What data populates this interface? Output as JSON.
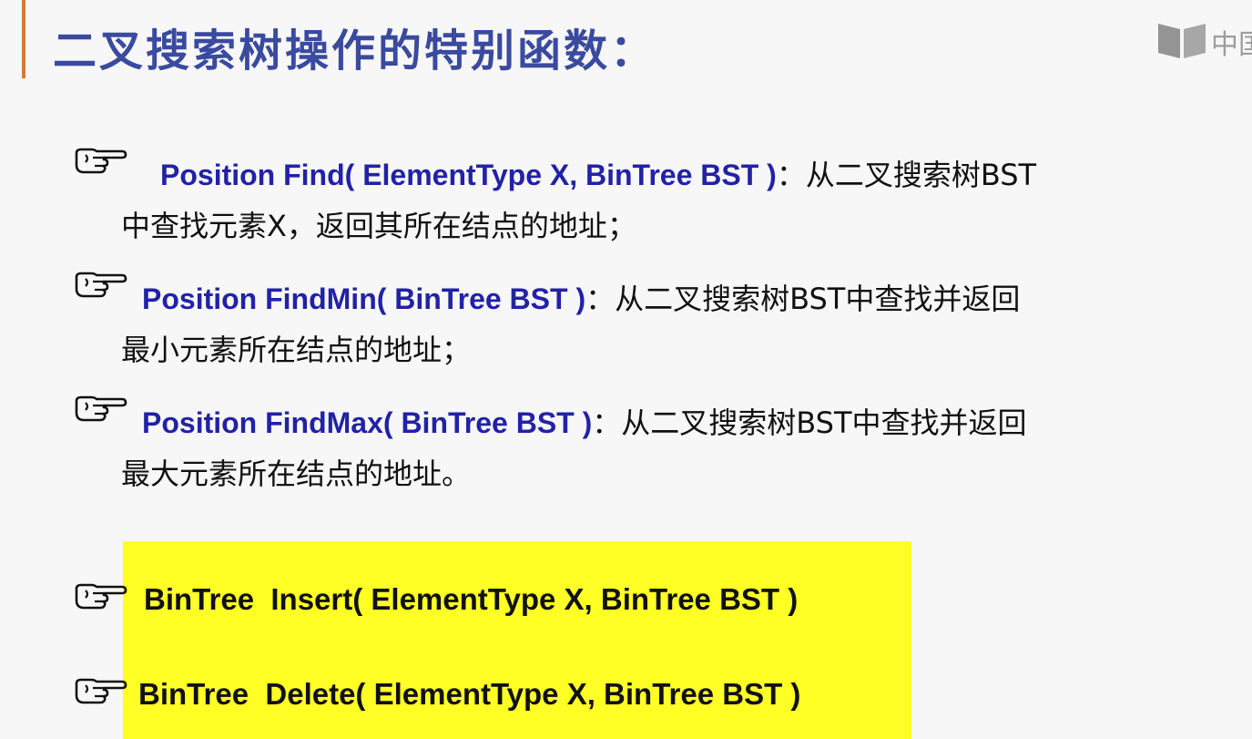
{
  "title": "二叉搜索树操作的特别函数：",
  "logo": {
    "text": "中国"
  },
  "items": [
    {
      "signature": "Position Find( ElementType X, BinTree BST )",
      "desc_line1": "：从二叉搜索树BST",
      "desc_line2": "中查找元素X，返回其所在结点的地址；"
    },
    {
      "signature": "Position FindMin( BinTree BST )",
      "desc_line1": "：从二叉搜索树BST中查找并返回",
      "desc_line2": "最小元素所在结点的地址；"
    },
    {
      "signature": "Position FindMax( BinTree BST )",
      "desc_line1": "：从二叉搜索树BST中查找并返回",
      "desc_line2": "最大元素所在结点的地址。"
    }
  ],
  "highlighted": [
    {
      "signature": "BinTree  Insert( ElementType X, BinTree BST )"
    },
    {
      "signature": "BinTree  Delete( ElementType X, BinTree BST )"
    }
  ],
  "colors": {
    "title": "#3a4a9f",
    "signature": "#2222a6",
    "highlight": "#ffff26",
    "accent_bar": "#d47a3a"
  },
  "icons": [
    "pointing-hand-icon"
  ]
}
